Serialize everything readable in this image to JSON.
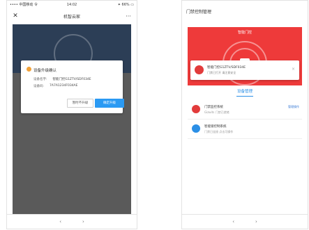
{
  "phone1": {
    "status_left": "•••• 中国移动 令",
    "status_center": "14:02",
    "status_right": "✦ 66% ▭",
    "title": "机智云家",
    "close_icon": "✕",
    "more_icon": "···",
    "dialog": {
      "title": "设备升级确认",
      "rows": [
        {
          "label": "设备名字:",
          "value": "智能门控G1ZTV/SDF034E"
        },
        {
          "label": "设备码:",
          "value": "7A7A1234F034AE"
        }
      ],
      "cancel": "暂时不升级",
      "ok": "确定升级"
    },
    "nav": [
      "‹",
      "›"
    ]
  },
  "phone2": {
    "title": "门禁控制管理",
    "bar": "智能门控",
    "notif_line1": "智能门控G1ZTV/SDF034E",
    "notif_line2": "门禁已打开 请注意安全",
    "notif_close": "×",
    "tab": "设备管理",
    "items": [
      {
        "name": "门禁监控系统",
        "sub": "Gizwits 门禁已就绪",
        "action": "管理操作",
        "color": "#e23b3b"
      },
      {
        "name": "智能锁控制系统",
        "sub": "门禁已连接 点击可操作",
        "action": "",
        "color": "#2b8fe6"
      }
    ],
    "nav": [
      "‹",
      "›"
    ]
  }
}
